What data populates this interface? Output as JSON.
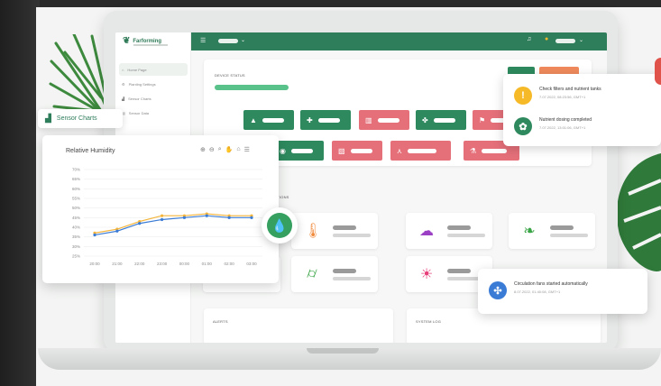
{
  "app": {
    "brand": "Farforming"
  },
  "sidebar": {
    "items": [
      {
        "label": "Home Page",
        "icon": "home-icon"
      },
      {
        "label": "Planting Settings",
        "icon": "settings-icon"
      },
      {
        "label": "Sensor Charts",
        "icon": "chart-icon"
      },
      {
        "label": "Sensor Data",
        "icon": "data-icon"
      }
    ]
  },
  "device_status": {
    "title": "DEVICE STATUS"
  },
  "sections": {
    "conditions": "ITIONS",
    "alerts": "ALERTS",
    "system_log": "SYSTEM LOG"
  },
  "chart_tab": {
    "label": "Sensor Charts"
  },
  "chart": {
    "toolbar_icons": [
      "zoom-in-icon",
      "zoom-out-icon",
      "magnify-icon",
      "pan-icon",
      "home-icon",
      "menu-icon"
    ]
  },
  "chart_data": {
    "type": "line",
    "title": "Relative Humidity",
    "x": [
      "20:00",
      "21:00",
      "22:00",
      "23:00",
      "00:00",
      "01:00",
      "02:00",
      "03:00"
    ],
    "series": [
      {
        "values": [
          37,
          39,
          43,
          46,
          46,
          47,
          46,
          46
        ]
      },
      {
        "values": [
          36,
          38,
          42,
          44,
          45,
          46,
          45,
          45
        ]
      }
    ],
    "yticks": [
      "70%",
      "65%",
      "60%",
      "55%",
      "50%",
      "45%",
      "40%",
      "35%",
      "30%",
      "25%"
    ],
    "ylim": [
      25,
      70
    ],
    "colors": [
      "#f4b43a",
      "#3a7bd5"
    ],
    "grid": true
  },
  "notifications": [
    {
      "title": "Check filters and nutrient tanks",
      "time": "7.07.2022, 08:23:56, GMT+1",
      "color": "#f6b928",
      "symbol": "!"
    },
    {
      "title": "Nutrient dosing completed",
      "time": "7.07.2022, 13:01:06, GMT+1",
      "color": "#2e8a5e",
      "symbol": "✿"
    }
  ],
  "circulation": {
    "title": "Circulation fans started automatically",
    "time": "8.07.2022, 01:40:08, GMT+1",
    "color": "#3a7bd5",
    "symbol": "✣"
  },
  "colors": {
    "primary": "#2e7d5b",
    "danger": "#e5707a",
    "warning": "#f6b928"
  }
}
